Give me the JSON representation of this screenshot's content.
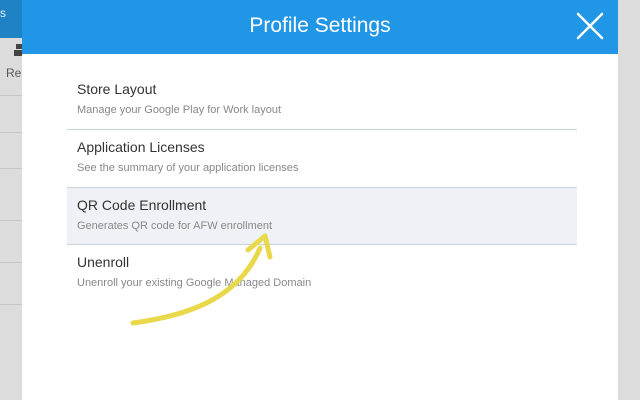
{
  "background": {
    "header_text": "s",
    "toolbar_label": "Re"
  },
  "modal": {
    "title": "Profile Settings",
    "close_icon": "close-icon",
    "items": [
      {
        "title": "Store Layout",
        "description": "Manage your Google Play for Work layout"
      },
      {
        "title": "Application Licenses",
        "description": "See the summary of your application licenses"
      },
      {
        "title": "QR Code Enrollment",
        "description": "Generates QR code for AFW enrollment"
      },
      {
        "title": "Unenroll",
        "description": "Unenroll your existing Google Managed Domain"
      }
    ]
  },
  "annotation": {
    "color": "#e8d84a",
    "icon": "arrow-annotation"
  },
  "colors": {
    "header": "#2196e6",
    "selected_row": "#eef2f7"
  }
}
